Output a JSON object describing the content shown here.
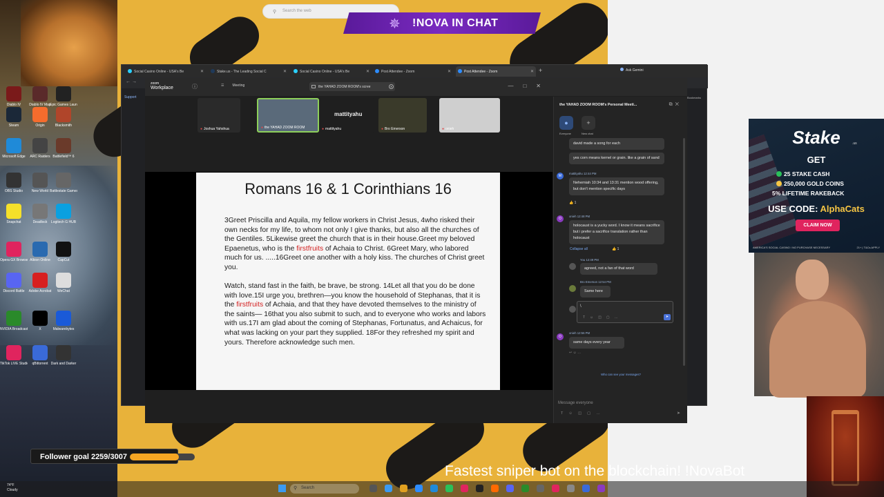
{
  "colors": {
    "accent": "#8ed05a",
    "scripture_highlight": "#d21f1f",
    "nova_purple": "#7a2ac0",
    "stake_red": "#e0245e",
    "follower_bar": "#f5a623",
    "background_yellow": "#e8b23a"
  },
  "desktop_icons": [
    {
      "label": "Diablo IV",
      "color": "#7a1a1a"
    },
    {
      "label": "Diablo IV Map",
      "color": "#5a2a2a"
    },
    {
      "label": "Epic Games Launcher",
      "color": "#222"
    },
    {
      "label": "Steam",
      "color": "#1b2838"
    },
    {
      "label": "Origin",
      "color": "#f56c2d"
    },
    {
      "label": "Blacksmith",
      "color": "#b0452a"
    },
    {
      "label": "Microsoft Edge",
      "color": "#1f8ad8"
    },
    {
      "label": "ARC Raiders",
      "color": "#444"
    },
    {
      "label": "Battlefield™ 6",
      "color": "#6a3a2a"
    },
    {
      "label": "OBS Studio",
      "color": "#333"
    },
    {
      "label": "New World",
      "color": "#555"
    },
    {
      "label": "Battlestate Games L...",
      "color": "#666"
    },
    {
      "label": "Snapchat",
      "color": "#f5e02a"
    },
    {
      "label": "Deadlock",
      "color": "#777"
    },
    {
      "label": "Logitech G HUB",
      "color": "#0aa0e0"
    },
    {
      "label": "Opera GX Browser",
      "color": "#e0245e"
    },
    {
      "label": "Albion Online",
      "color": "#2a6ab0"
    },
    {
      "label": "CapCut",
      "color": "#111"
    },
    {
      "label": "Discord Battle",
      "color": "#5865f2"
    },
    {
      "label": "Adobe Acrobat",
      "color": "#d71f1f"
    },
    {
      "label": "WeChat",
      "color": "#ddd"
    },
    {
      "label": "NVIDIA Broadcast",
      "color": "#2a8a2a"
    },
    {
      "label": "X",
      "color": "#000"
    },
    {
      "label": "Malwarebytes",
      "color": "#1a5ad8"
    },
    {
      "label": "TikTok LIVE Studio",
      "color": "#e0245e"
    },
    {
      "label": "qBittorrent",
      "color": "#3a6ad8"
    },
    {
      "label": "Dark and Darker",
      "color": "#333"
    }
  ],
  "top_search": {
    "placeholder": "Search the web"
  },
  "nova_banner": {
    "text": "!NOVA   IN CHAT"
  },
  "browser": {
    "tabs": [
      {
        "title": "Social Casino Online - USA's Be",
        "fav": "#2ad0ff"
      },
      {
        "title": "Stake.us - The Leading Social C",
        "fav": "#1f3a5a"
      },
      {
        "title": "Social Casino Online - USA's Be",
        "fav": "#2ad0ff"
      },
      {
        "title": "Post Attendee - Zoom",
        "fav": "#2d8cff"
      },
      {
        "title": "Post Attendee - Zoom",
        "fav": "#2d8cff"
      }
    ],
    "ask_gemini": "Ask Gemini",
    "support": "Support",
    "bookmarks": "Bookmarks"
  },
  "zoom": {
    "logo_top": "zoom",
    "logo_bottom": "Workplace",
    "meeting_label": "Meeting",
    "window_tab": "the YAHAD ZOOM ROOM's scree",
    "participants": [
      {
        "name": "Joshua Yahshua",
        "bg": "#2a2a2a"
      },
      {
        "name": "the YAHAD ZOOM ROOM",
        "bg": "#5a6a7a"
      },
      {
        "name": "mattityahu",
        "bg": "#1f1f1f"
      },
      {
        "name": "Bro Emerson",
        "bg": "#3a3a2a"
      },
      {
        "name": "onieh",
        "bg": "#cfcfcf"
      }
    ],
    "big_name": "mattityahu",
    "slide": {
      "title": "Romans 16 & 1 Corinthians 16",
      "p1_a": "3Greet Priscilla and Aquila, my fellow workers in Christ Jesus, 4who risked their own necks for my life, to whom not only I give thanks, but also all the churches of the Gentiles. 5Likewise greet the church that is in their house.Greet my beloved Epaenetus, who is the ",
      "p1_red": "firstfruits",
      "p1_b": " of Achaia to Christ. 6Greet Mary, who labored much for us. .....16Greet one another with a holy kiss. The churches of Christ greet you.",
      "p2_a": "Watch, stand fast in the faith, be brave, be strong. 14Let all that you do be done with love.15I urge you, brethren—you know the household of Stephanas, that it is the ",
      "p2_red": "firstfruits",
      "p2_b": " of Achaia, and that they have devoted themselves to the ministry of the saints— 16that you also submit to such, and to everyone who works and labors with us.17I am glad about the coming of Stephanas, Fortunatus, and Achaicus, for what was lacking on your part they supplied. 18For they refreshed my spirit and yours. Therefore acknowledge such men."
    }
  },
  "chat": {
    "header": "the YAHAD ZOOM ROOM's Personal Meeti...",
    "tab_everyone": "Everyone",
    "tab_new_chat": "New chat",
    "messages": {
      "m0": "david made a song for each",
      "m1": "yes corn means kernel or grain. like a grain of sand",
      "m2_meta": "mattityahu 12:44 PM",
      "m2": "Nehemiah 10:34 and 13:31 mention wood offering, but don't mention specific days",
      "m2_react": "👍 1",
      "m3_meta": "onieh 12:48 PM",
      "m3": "holocaust is a yucky word. I know it means sacrifice but i prefer a sacrifice translation rather than holocaust",
      "collapse": "Collapse all",
      "m3_react": "👍 1",
      "m4_meta": "You 12:49 PM",
      "m4": "agreed, not a fan of that word",
      "m5_meta": "Bro Emerson 12:54 PM",
      "m5": "Same here",
      "reply_cursor": "\\",
      "m6_meta": "onieh 12:56 PM",
      "m6": "same days every year"
    },
    "who_can_see": "Who can see your messages?",
    "input_placeholder": "Message everyone"
  },
  "stake_ad": {
    "logo": "Stake",
    "logo_sub": ".us",
    "get": "GET",
    "line1": "25 STAKE CASH",
    "line2": "250,000 GOLD COINS",
    "line3": "5% LIFETIME RAKEBACK",
    "code_label": "USE CODE: ",
    "code_value": "AlphaCats",
    "claim": "CLAIM NOW",
    "fine_left": "AMERICA'S SOCIAL CASINO / NO PURCHASE NECESSARY",
    "fine_right": "21+ | T&Cs APPLY"
  },
  "follower_goal": {
    "label": "Follower goal 2259/3007",
    "progress": 0.751
  },
  "ticker": "Fastest sniper bot on the blockchain! !NovaBot",
  "taskbar": {
    "weather_temp": "74°F",
    "weather_desc": "Cloudy",
    "search": "Search"
  }
}
